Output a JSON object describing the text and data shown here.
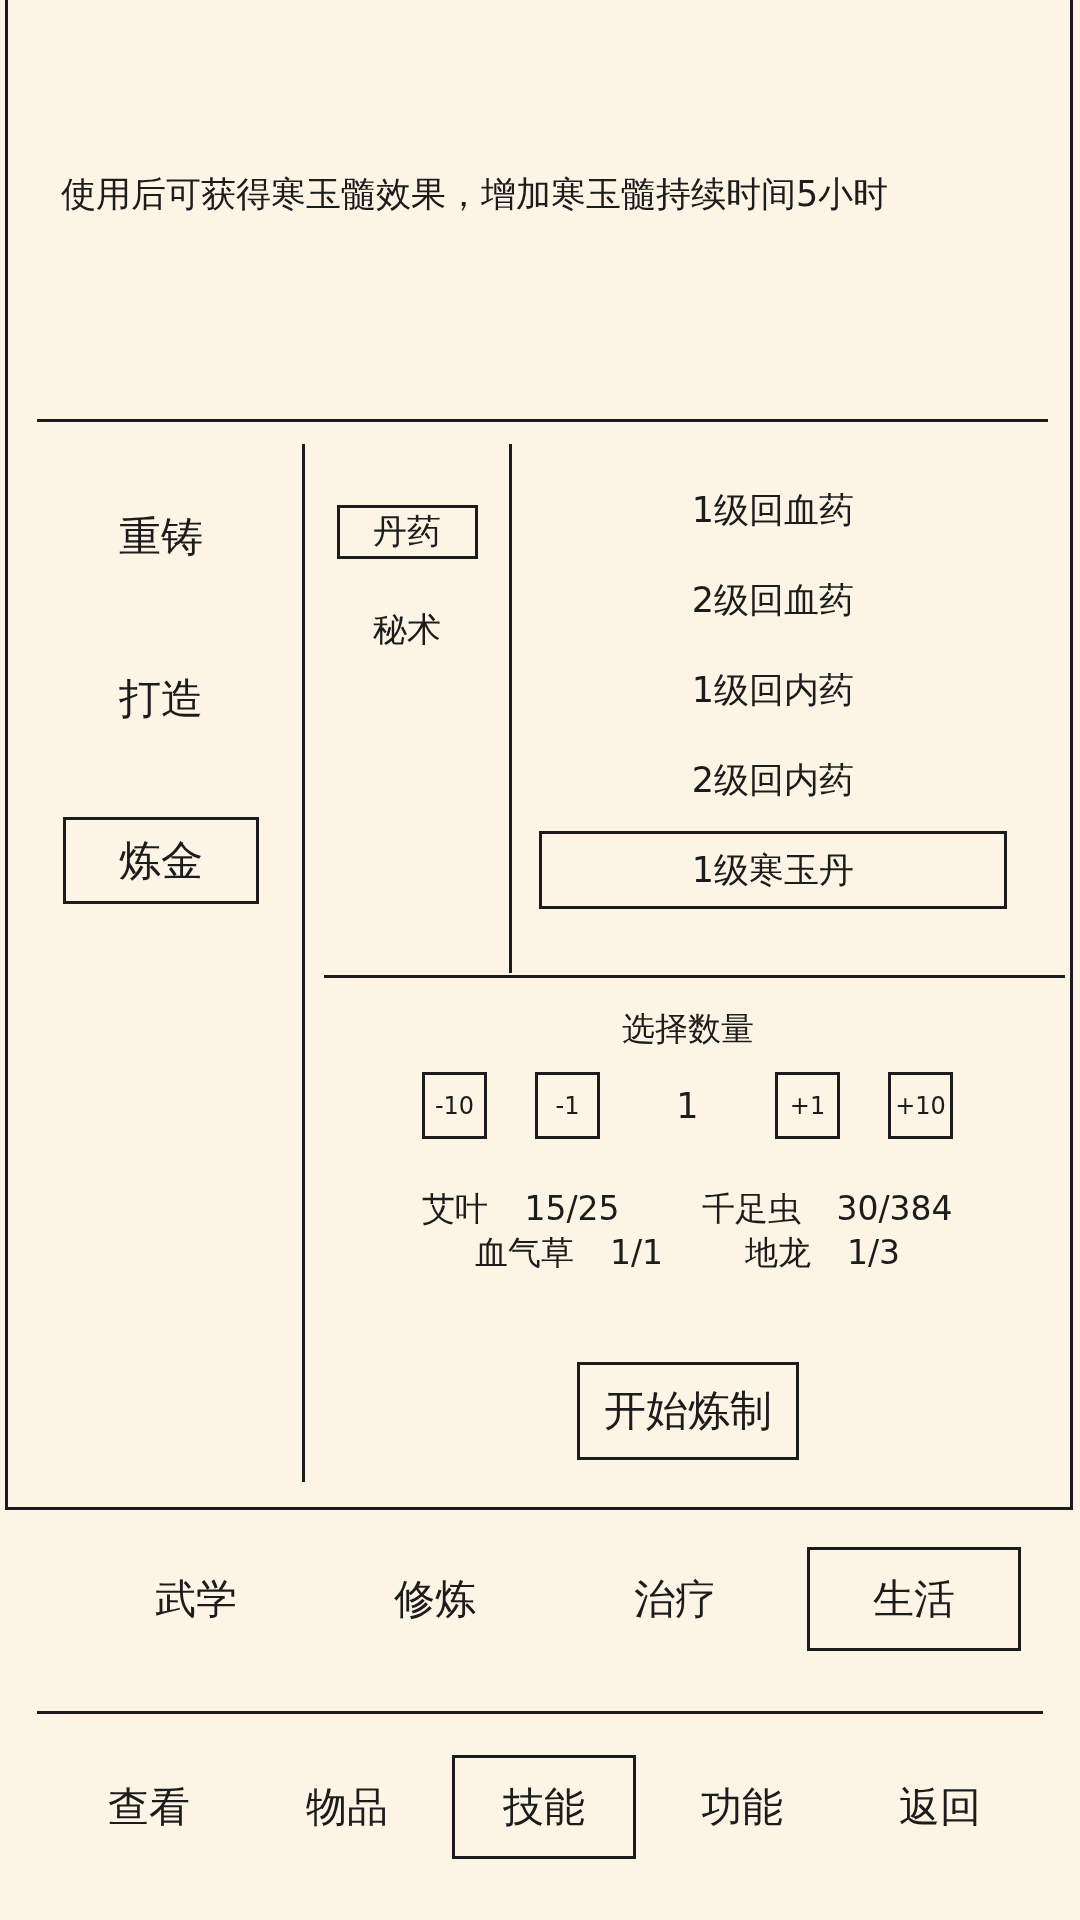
{
  "item_description": "使用后可获得寒玉髓效果，增加寒玉髓持续时间5小时",
  "crafting_categories": [
    {
      "label": "重铸",
      "selected": false
    },
    {
      "label": "打造",
      "selected": false
    },
    {
      "label": "炼金",
      "selected": true
    }
  ],
  "recipe_types": [
    {
      "label": "丹药",
      "selected": true
    },
    {
      "label": "秘术",
      "selected": false
    }
  ],
  "recipes": [
    {
      "label": "1级回血药",
      "selected": false
    },
    {
      "label": "2级回血药",
      "selected": false
    },
    {
      "label": "1级回内药",
      "selected": false
    },
    {
      "label": "2级回内药",
      "selected": false
    },
    {
      "label": "1级寒玉丹",
      "selected": true
    }
  ],
  "quantity": {
    "title": "选择数量",
    "decrease_buttons": [
      "-10",
      "-1"
    ],
    "value": "1",
    "increase_buttons": [
      "+1",
      "+10"
    ]
  },
  "material_rows": [
    [
      {
        "name": "艾叶",
        "count": "15/25"
      },
      {
        "name": "千足虫",
        "count": "30/384"
      }
    ],
    [
      {
        "name": "血气草",
        "count": "1/1"
      },
      {
        "name": "地龙",
        "count": "1/3"
      }
    ]
  ],
  "start_button": "开始炼制",
  "skill_tabs": [
    {
      "label": "武学",
      "selected": false
    },
    {
      "label": "修炼",
      "selected": false
    },
    {
      "label": "治疗",
      "selected": false
    },
    {
      "label": "生活",
      "selected": true
    }
  ],
  "bottom_nav": [
    {
      "label": "查看",
      "selected": false
    },
    {
      "label": "物品",
      "selected": false
    },
    {
      "label": "技能",
      "selected": true
    },
    {
      "label": "功能",
      "selected": false
    },
    {
      "label": "返回",
      "selected": false
    }
  ]
}
